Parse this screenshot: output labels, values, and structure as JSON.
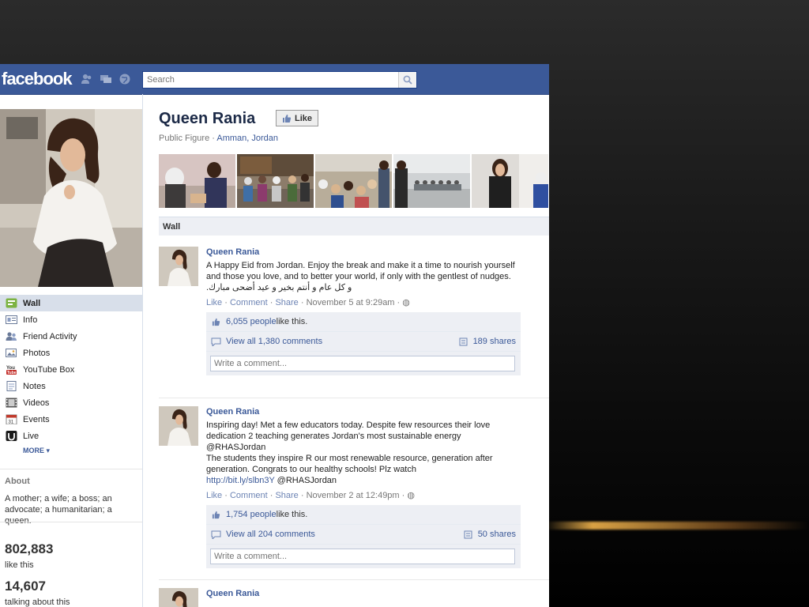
{
  "topbar": {
    "logo": "facebook",
    "search_placeholder": "Search"
  },
  "page": {
    "name": "Queen Rania",
    "like_button": "Like",
    "category": "Public Figure",
    "separator": " · ",
    "location": "Amman, Jordan",
    "wall_tab": "Wall"
  },
  "sidebar": {
    "nav": [
      {
        "label": "Wall",
        "icon": "wall-icon"
      },
      {
        "label": "Info",
        "icon": "info-icon"
      },
      {
        "label": "Friend Activity",
        "icon": "friends-icon"
      },
      {
        "label": "Photos",
        "icon": "photos-icon"
      },
      {
        "label": "YouTube Box",
        "icon": "youtube-icon"
      },
      {
        "label": "Notes",
        "icon": "notes-icon"
      },
      {
        "label": "Videos",
        "icon": "videos-icon"
      },
      {
        "label": "Events",
        "icon": "events-icon"
      },
      {
        "label": "Live",
        "icon": "live-icon"
      }
    ],
    "more": "MORE",
    "about_heading": "About",
    "about_text": "A mother; a wife; a boss; an advocate; a humanitarian; a queen.",
    "likes_count": "802,883",
    "likes_label": "like this",
    "talking_count": "14,607",
    "talking_label": "talking about this"
  },
  "posts": [
    {
      "author": "Queen Rania",
      "text_line1": "A Happy Eid from Jordan. Enjoy the break and make it a time to nourish yourself and those you love, and to better your world, if only with the gentlest of nudges.",
      "text_arabic": "و كل عام و أنتم بخير و عيد أضحى مبارك.",
      "actions": {
        "like": "Like",
        "comment": "Comment",
        "share": "Share",
        "time": "November 5 at 9:29am"
      },
      "likes_link": "6,055 people",
      "likes_suffix": " like this.",
      "comments": "View all 1,380 comments",
      "shares": "189 shares",
      "write_placeholder": "Write a comment..."
    },
    {
      "author": "Queen Rania",
      "text_line1": "Inspiring day! Met a few educators today. Despite few resources their love dedication 2 teaching generates Jordan's most sustainable energy @RHASJordan",
      "text_line2": "The students they inspire R our most renewable resource, generation after generation. Congrats to our healthy schools! Plz watch",
      "link": "http://bit.ly/slbn3Y",
      "link_suffix": " @RHASJordan",
      "actions": {
        "like": "Like",
        "comment": "Comment",
        "share": "Share",
        "time": "November 2 at 12:49pm"
      },
      "likes_link": "1,754 people",
      "likes_suffix": " like this.",
      "comments": "View all 204 comments",
      "shares": "50 shares",
      "write_placeholder": "Write a comment..."
    },
    {
      "author": "Queen Rania"
    }
  ],
  "colors": {
    "fb_blue": "#3b5998",
    "link": "#3b5998",
    "light_bg": "#edeff4"
  }
}
